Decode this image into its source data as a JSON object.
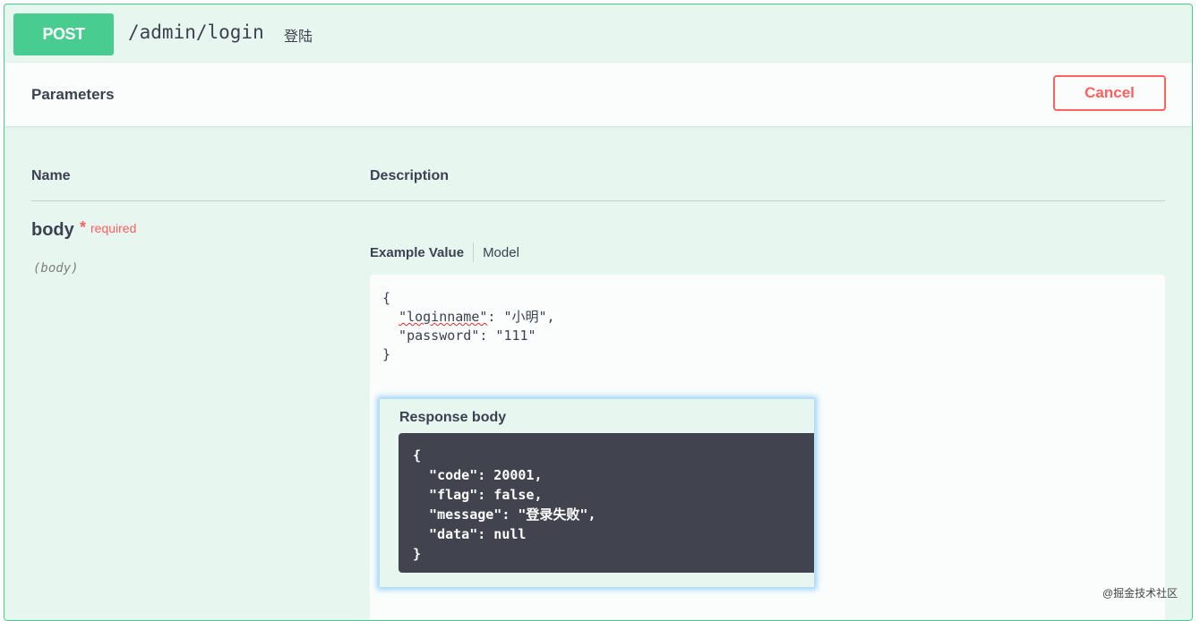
{
  "operation": {
    "method": "POST",
    "path": "/admin/login",
    "description": "登陆"
  },
  "parameters": {
    "title": "Parameters",
    "cancel_label": "Cancel",
    "col_name": "Name",
    "col_description": "Description",
    "param": {
      "name": "body",
      "required_star": "*",
      "required_label": "required",
      "location": "(body)"
    },
    "tabs": {
      "example": "Example Value",
      "model": "Model"
    },
    "body_lines": {
      "open": "{",
      "loginname_key": "\"loginname\"",
      "loginname_rest": ": \"小明\",",
      "password_line": "  \"password\": \"111\"",
      "close": "}"
    }
  },
  "response": {
    "title": "Response body",
    "body": "{\n  \"code\": 20001,\n  \"flag\": false,\n  \"message\": \"登录失败\",\n  \"data\": null\n}"
  },
  "watermark": "@掘金技术社区",
  "colors": {
    "post": "#49cc90",
    "cancel": "#ff6060",
    "block_bg": "#e8f6f0",
    "response_bg": "#41444e"
  },
  "icons": []
}
